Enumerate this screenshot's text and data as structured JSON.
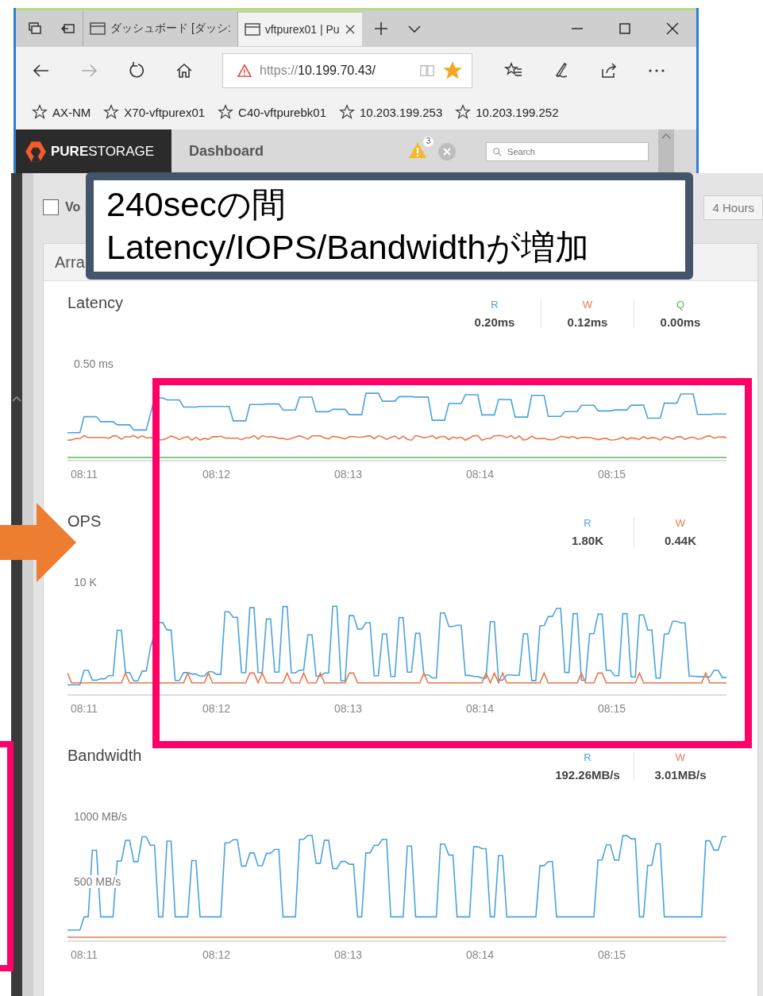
{
  "browser": {
    "tabs": [
      {
        "label": "ダッシュボード [ダッシ:",
        "selected": false
      },
      {
        "label": "vftpurex01 | Pu",
        "selected": true
      }
    ],
    "address": {
      "scheme": "https://",
      "host": "10.199.70.43/",
      "favorited": true
    },
    "favorites": [
      "AX-NM",
      "X70-vftpurex01",
      "C40-vftpurebk01",
      "10.203.199.253",
      "10.203.199.252"
    ]
  },
  "app_header": {
    "logo_bold": "PURE",
    "logo_light": "STORAGE",
    "title": "Dashboard",
    "alert_count": "3",
    "search": {
      "placeholder": "Search"
    }
  },
  "toolbar": {
    "checkbox": {
      "label": "Vo",
      "checked": false
    },
    "range_button": "4 Hours"
  },
  "panel_title": "Arra",
  "metrics": [
    {
      "title": "Latency",
      "y_ticks": [
        "0.50 ms"
      ],
      "readings": [
        {
          "label": "R",
          "value": "0.20ms",
          "color": "#4aa3df"
        },
        {
          "label": "W",
          "value": "0.12ms",
          "color": "#e8794a"
        },
        {
          "label": "Q",
          "value": "0.00ms",
          "color": "#5cb85c"
        }
      ],
      "x_ticks": [
        "08:11",
        "08:12",
        "08:13",
        "08:14",
        "08:15"
      ]
    },
    {
      "title": "OPS",
      "y_ticks": [
        "10 K"
      ],
      "readings": [
        {
          "label": "R",
          "value": "1.80K",
          "color": "#4aa3df"
        },
        {
          "label": "W",
          "value": "0.44K",
          "color": "#e8794a"
        }
      ],
      "x_ticks": [
        "08:11",
        "08:12",
        "08:13",
        "08:14",
        "08:15"
      ]
    },
    {
      "title": "Bandwidth",
      "y_ticks": [
        "1000 MB/s",
        "500 MB/s"
      ],
      "readings": [
        {
          "label": "R",
          "value": "192.26MB/s",
          "color": "#4aa3df"
        },
        {
          "label": "W",
          "value": "3.01MB/s",
          "color": "#e8794a"
        }
      ],
      "x_ticks": [
        "08:11",
        "08:12",
        "08:13",
        "08:14",
        "08:15"
      ]
    }
  ],
  "annotation": {
    "lines": [
      "240secの間",
      "Latency/IOPS/Bandwidthが増加"
    ]
  }
}
